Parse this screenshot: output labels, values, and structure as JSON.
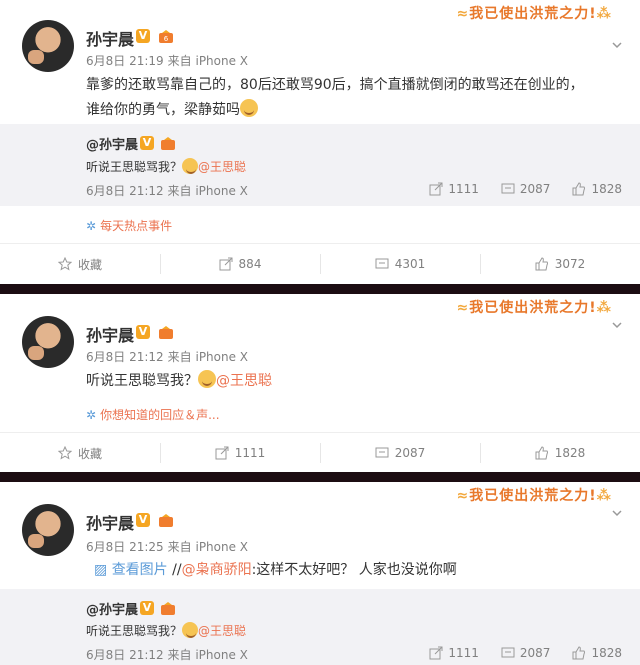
{
  "promo_text": "我已使出洪荒之力!",
  "posts": [
    {
      "author": "孙宇晨",
      "time": "6月8日 21:19",
      "source": "来自 iPhone X",
      "text_a": "靠爹的还敢骂靠自己的，80后还敢骂90后，搞个直播就倒闭的敢骂还在创业的，",
      "text_b": "谁给你的勇气，梁静茹吗",
      "repost": {
        "author": "@孙宇晨",
        "text": "听说王思聪骂我？",
        "mention": "@王思聪",
        "time": "6月8日 21:12",
        "source": "来自 iPhone X",
        "reposts": "1111",
        "comments": "2087",
        "likes": "1828"
      },
      "topic": "每天热点事件",
      "actions": {
        "favorite": "收藏",
        "reposts": "884",
        "comments": "4301",
        "likes": "3072"
      }
    },
    {
      "author": "孙宇晨",
      "time": "6月8日 21:12",
      "source": "来自 iPhone X",
      "text": "听说王思聪骂我？",
      "mention": "@王思聪",
      "topic": "你想知道的回应＆声...",
      "actions": {
        "favorite": "收藏",
        "reposts": "1111",
        "comments": "2087",
        "likes": "1828"
      }
    },
    {
      "author": "孙宇晨",
      "time": "6月8日 21:25",
      "source": "来自 iPhone X",
      "view_image": "查看图片",
      "reply_prefix": "//",
      "reply_mention": "@枭商骄阳",
      "reply_text": ":这样不太好吧？ 人家也没说你啊",
      "repost": {
        "author": "@孙宇晨",
        "text": "听说王思聪骂我？",
        "mention": "@王思聪",
        "time": "6月8日 21:12",
        "source": "来自 iPhone X",
        "reposts": "1111",
        "comments": "2087",
        "likes": "1828"
      }
    }
  ]
}
